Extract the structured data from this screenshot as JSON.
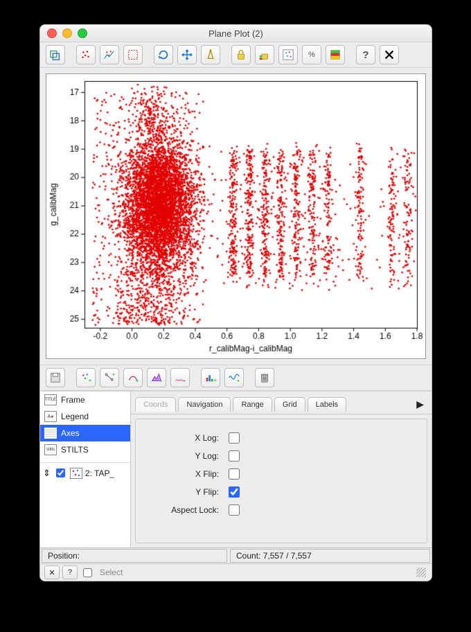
{
  "window": {
    "title": "Plane Plot (2)"
  },
  "sidebar": {
    "items": [
      "Frame",
      "Legend",
      "Axes",
      "STILTS"
    ],
    "selected": "Axes",
    "layer_label": "2: TAP_"
  },
  "tabs": [
    "Coords",
    "Navigation",
    "Range",
    "Grid",
    "Labels"
  ],
  "form": {
    "xlog": "X Log:",
    "ylog": "Y Log:",
    "xflip": "X Flip:",
    "yflip": "Y Flip:",
    "aspect": "Aspect Lock:",
    "yflip_checked": true
  },
  "status": {
    "position_label": "Position:",
    "count_label": "Count:",
    "count_value": "7,557 / 7,557"
  },
  "footer": {
    "select": "Select"
  },
  "chart_data": {
    "type": "scatter",
    "title": "",
    "xlabel": "r_calibMag-i_calibMag",
    "ylabel": "g_calibMag",
    "xlim": [
      -0.3,
      1.8
    ],
    "ylim": [
      25.3,
      16.6
    ],
    "xticks": [
      -0.2,
      0.0,
      0.2,
      0.4,
      0.6,
      0.8,
      1.0,
      1.2,
      1.4,
      1.6,
      1.8
    ],
    "yticks": [
      17,
      18,
      19,
      20,
      21,
      22,
      23,
      24,
      25
    ],
    "n_points": 7557,
    "color": "#e20000",
    "distribution_note": "dense diffuse cloud centered near x≈0.1–0.3, y≈19–24; discrete vertical striations at x≈0.64,0.74,0.84,0.94,1.04,1.14,1.24,1.44,1.64,1.74 spanning y≈19–23.5",
    "stripe_x": [
      0.64,
      0.74,
      0.84,
      0.94,
      1.04,
      1.14,
      1.24,
      1.44,
      1.64,
      1.74
    ],
    "cloud_center": {
      "x": 0.15,
      "y": 21.0
    },
    "cloud_spread": {
      "x": 0.15,
      "y": 2.2
    }
  }
}
